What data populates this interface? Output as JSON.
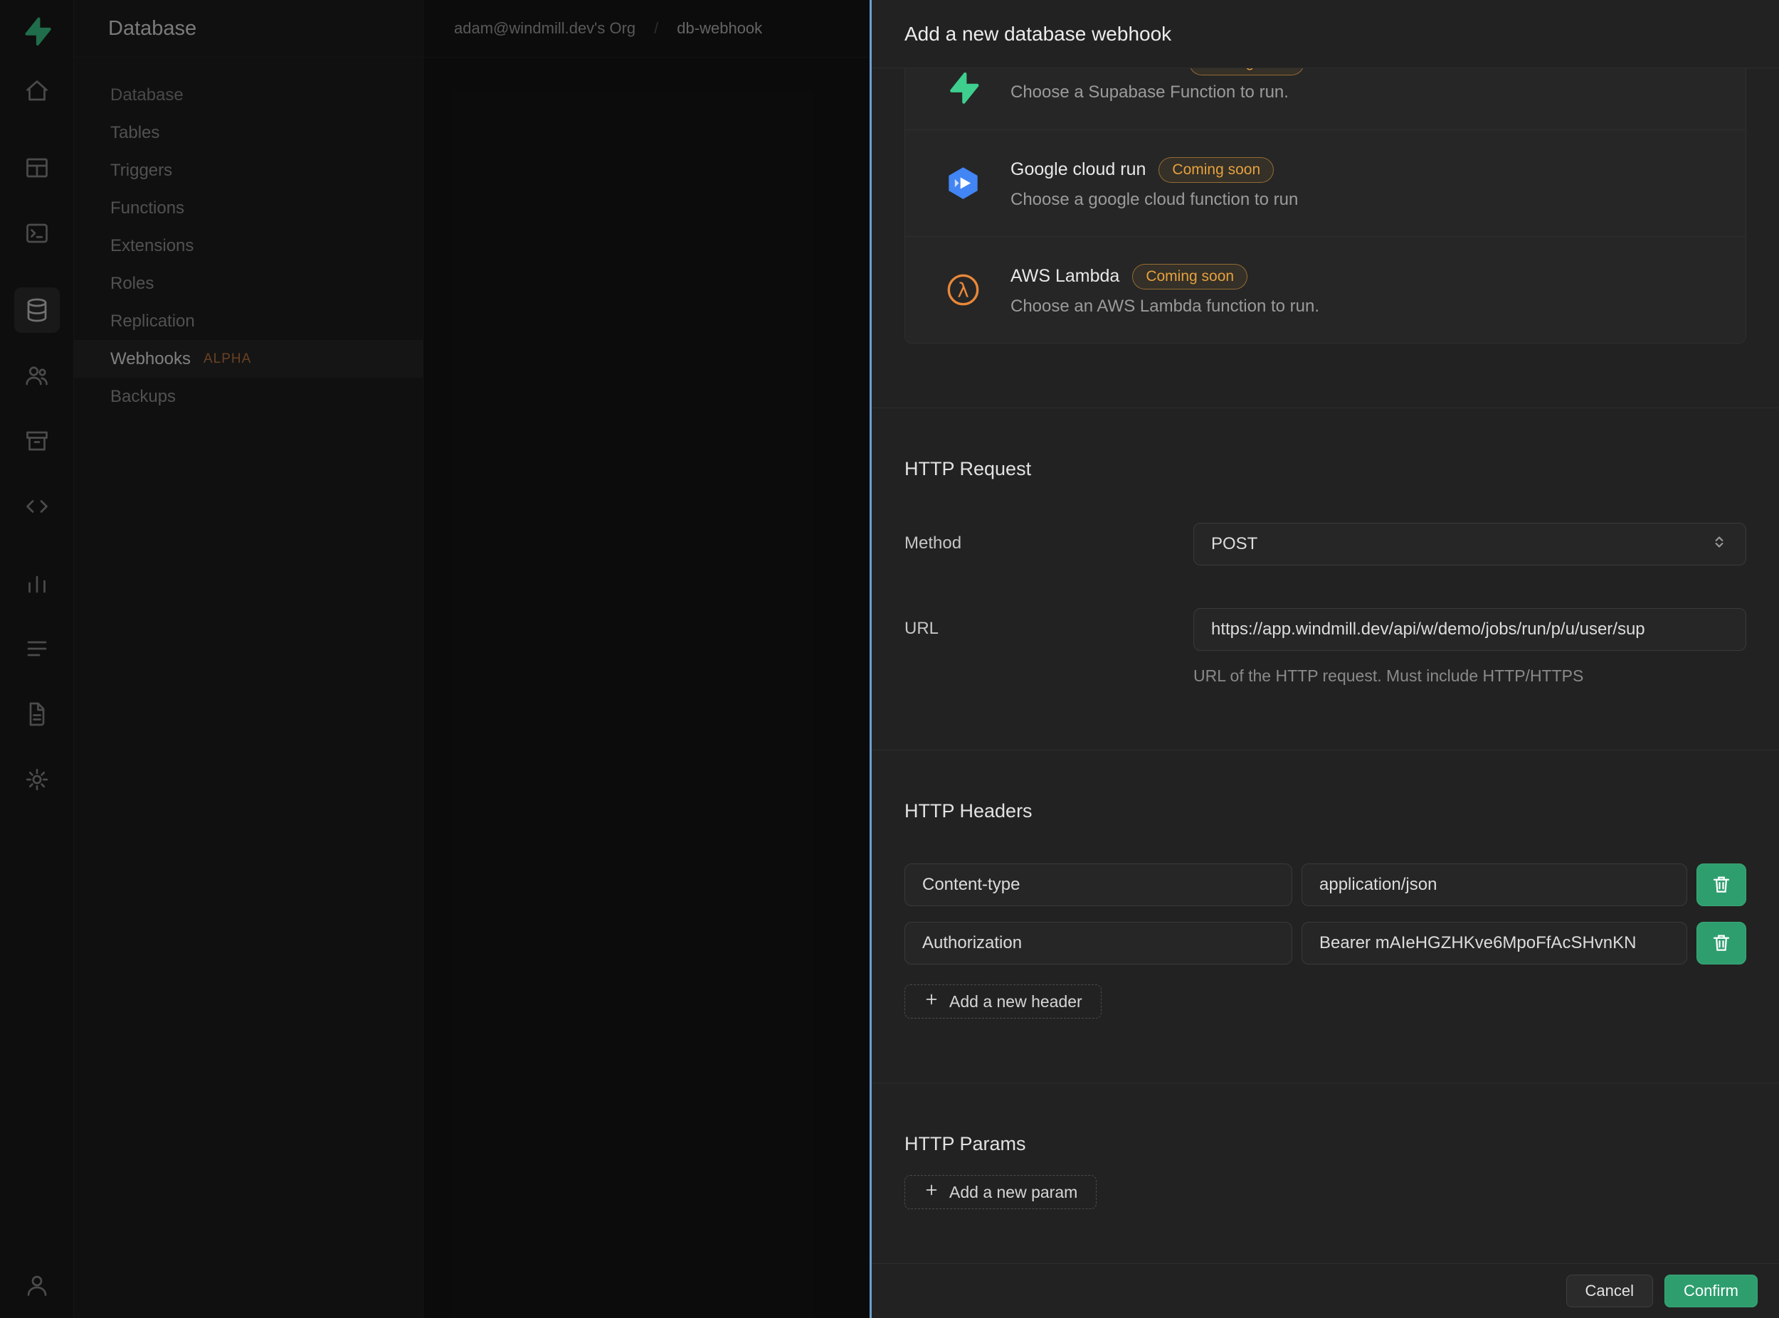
{
  "colors": {
    "brand_green": "#3ecf8e",
    "badge_orange": "#e5a13e",
    "panel_divider_blue": "#6b9fce",
    "confirm_green": "#2e9e6e",
    "lambda_orange": "#e8883a",
    "cloud_run_blue": "#4285f4"
  },
  "rail": {
    "icons": [
      "supabase-logo-icon",
      "home-icon",
      "table-editor-icon",
      "sql-editor-icon",
      "database-icon",
      "auth-icon",
      "storage-icon",
      "api-icon",
      "reports-icon",
      "logs-icon",
      "docs-icon",
      "settings-icon",
      "account-icon"
    ],
    "selected": "database-icon"
  },
  "sidebar": {
    "title": "Database",
    "items": [
      {
        "label": "Database"
      },
      {
        "label": "Tables"
      },
      {
        "label": "Triggers"
      },
      {
        "label": "Functions"
      },
      {
        "label": "Extensions"
      },
      {
        "label": "Roles"
      },
      {
        "label": "Replication"
      },
      {
        "label": "Webhooks",
        "badge": "ALPHA",
        "active": true
      },
      {
        "label": "Backups"
      }
    ]
  },
  "breadcrumb": {
    "org": "adam@windmill.dev's Org",
    "separator": "/",
    "project": "db-webhook"
  },
  "panel": {
    "title": "Add a new database webhook",
    "webhook_types": [
      {
        "name": "",
        "badge": "Coming soon",
        "description": "Choose a Supabase Function to run.",
        "icon": "supabase-function-icon"
      },
      {
        "name": "Google cloud run",
        "badge": "Coming soon",
        "description": "Choose a google cloud function to run",
        "icon": "google-cloud-run-icon"
      },
      {
        "name": "AWS Lambda",
        "badge": "Coming soon",
        "description": "Choose an AWS Lambda function to run.",
        "icon": "aws-lambda-icon"
      }
    ],
    "http_request": {
      "heading": "HTTP Request",
      "method_label": "Method",
      "method_value": "POST",
      "url_label": "URL",
      "url_value": "https://app.windmill.dev/api/w/demo/jobs/run/p/u/user/sup",
      "url_help": "URL of the HTTP request. Must include HTTP/HTTPS"
    },
    "http_headers": {
      "heading": "HTTP Headers",
      "rows": [
        {
          "key": "Content-type",
          "value": "application/json"
        },
        {
          "key": "Authorization",
          "value": "Bearer mAIeHGZHKve6MpoFfAcSHvnKN"
        }
      ],
      "add_label": "Add a new header"
    },
    "http_params": {
      "heading": "HTTP Params",
      "add_label": "Add a new param"
    },
    "footer": {
      "cancel": "Cancel",
      "confirm": "Confirm"
    }
  }
}
